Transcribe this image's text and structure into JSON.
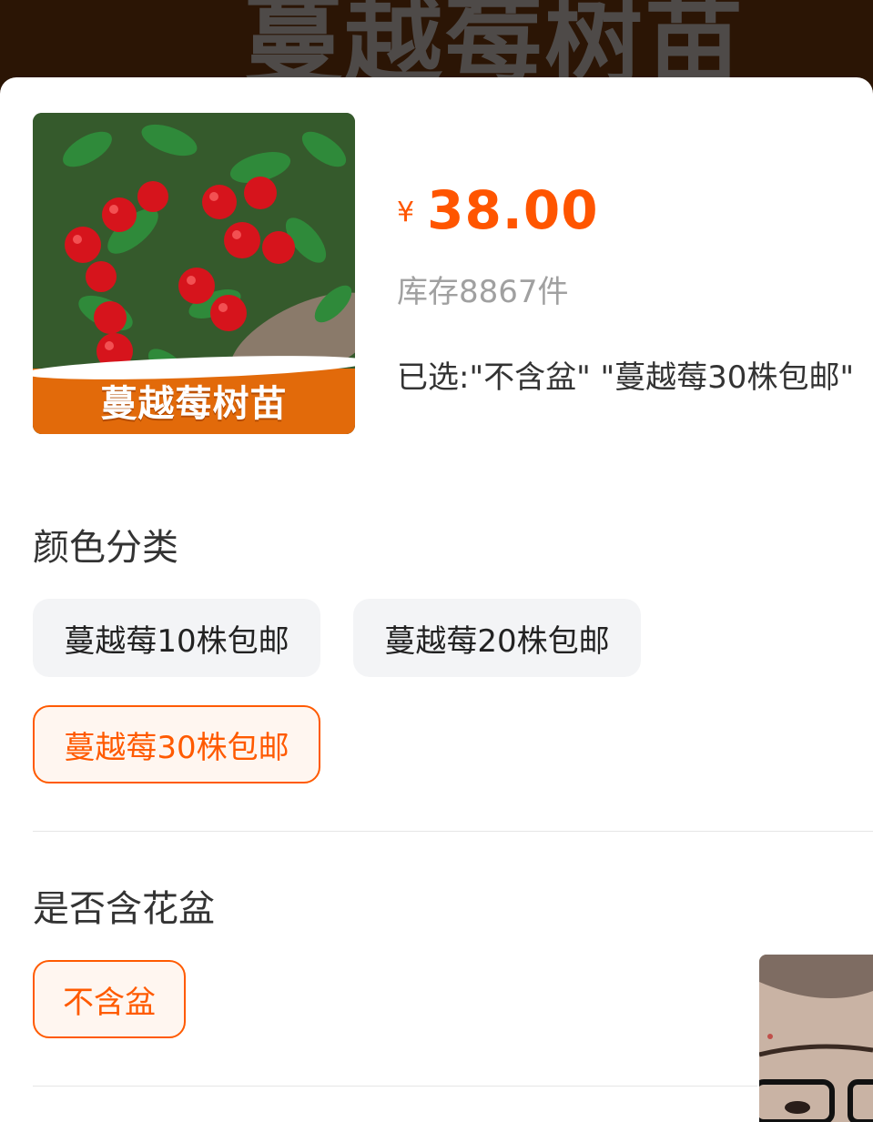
{
  "banner": {
    "title": "蔓越莓树苗"
  },
  "product": {
    "image_caption": "蔓越莓树苗",
    "currency": "¥",
    "price": "38.00",
    "stock": "库存8867件",
    "selected": "已选:\"不含盆\" \"蔓越莓30株包邮\""
  },
  "colors": {
    "accent": "#ff5500",
    "chip_bg": "#f3f4f6",
    "image_band": "#e26a0a"
  },
  "color_section": {
    "title": "颜色分类",
    "options": [
      {
        "label": "蔓越莓10株包邮",
        "selected": false
      },
      {
        "label": "蔓越莓20株包邮",
        "selected": false
      },
      {
        "label": "蔓越莓30株包邮",
        "selected": true
      }
    ]
  },
  "pot_section": {
    "title": "是否含花盆",
    "options": [
      {
        "label": "不含盆",
        "selected": true
      }
    ]
  }
}
